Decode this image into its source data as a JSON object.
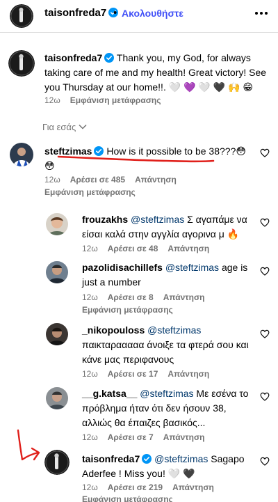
{
  "header": {
    "username": "taisonfreda7",
    "dot": "•",
    "follow_label": "Ακολουθήστε"
  },
  "caption": {
    "username": "taisonfreda7",
    "text": "Thank you, my God, for always taking care of me and my health! Great victory! See you Thursday at our home!!. 🤍 💜 🤍 🖤 🙌 😁",
    "time": "12ω",
    "translate_label": "Εμφάνιση μετάφρασης"
  },
  "for_you_label": "Για εσάς",
  "comments": [
    {
      "username": "steftzimas",
      "text": "How is it possible to be 38???😳",
      "text2": "😳",
      "time": "12ω",
      "likes": "Αρέσει σε 485",
      "reply": "Απάντηση",
      "translate": "Εμφάνιση μετάφρασης"
    },
    {
      "username": "frouzakhs",
      "mention": "@steftzimas",
      "text": "Σ αγαπάμε να είσαι καλά στην αγγλία αγορινα μ 🔥",
      "time": "12ω",
      "likes": "Αρέσει σε 48",
      "reply": "Απάντηση"
    },
    {
      "username": "pazolidisachillefs",
      "mention": "@steftzimas",
      "text": "age is just a number",
      "time": "12ω",
      "likes": "Αρέσει σε 8",
      "reply": "Απάντηση",
      "translate": "Εμφάνιση μετάφρασης"
    },
    {
      "username": "_nikopouloss",
      "mention": "@steftzimas",
      "text": "παικταρααααα άνοιξε τα φτερά σου και κάνε μας περιφανους",
      "time": "12ω",
      "likes": "Αρέσει σε 17",
      "reply": "Απάντηση"
    },
    {
      "username": "__g.katsa__",
      "mention": "@steftzimas",
      "text": "Με εσένα το πρόβλημα ήταν ότι δεν ήσουν 38, αλλιώς θα έπαιζες βασικός...",
      "time": "12ω",
      "likes": "Αρέσει σε 7",
      "reply": "Απάντηση"
    },
    {
      "username": "taisonfreda7",
      "mention": "@steftzimas",
      "text": "Sagapo Aderfee ! Miss you! 🤍 🖤",
      "time": "12ω",
      "likes": "Αρέσει σε 219",
      "reply": "Απάντηση",
      "translate": "Εμφάνιση μετάφρασης"
    }
  ],
  "colors": {
    "link_blue": "#4150f7",
    "mention_blue": "#00376b",
    "meta_gray": "#737373",
    "verified_blue": "#0095f6",
    "annotation_red": "#e0201b"
  }
}
